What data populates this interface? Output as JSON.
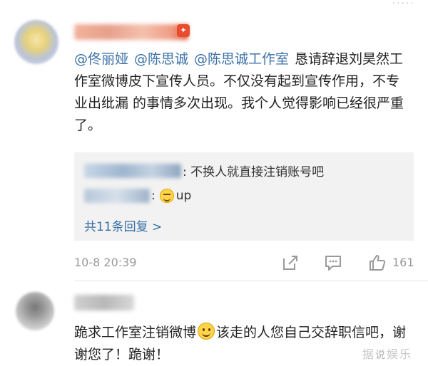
{
  "top": {
    "dots": "·····"
  },
  "comment1": {
    "mentions": [
      "@佟丽娅",
      "@陈思诚",
      "@陈思诚工作室"
    ],
    "body": "恳请辞退刘昊然工作室微博皮下宣传人员。不仅没有起到宣传作用，不专业出纰漏 的事情多次出现。我个人觉得影响已经很严重了。",
    "replies": [
      {
        "text": ": 不换人就直接注销账号吧"
      },
      {
        "text": ":",
        "emoji": "sweat-emoji",
        "suffix": "up"
      }
    ],
    "reply_count_link": "共11条回复 >",
    "timestamp": "10-8 20:39",
    "like_count": "161"
  },
  "comment2": {
    "body_before": "跪求工作室注销微博",
    "body_after": "该走的人您自己交辞职信吧，谢谢您了！跪谢！"
  },
  "watermark": {
    "left": "据",
    "middle": "说",
    "right": "娱乐"
  },
  "colors": {
    "link": "#3a6fa6",
    "meta": "#999999",
    "reply_bg": "#f2f2f2"
  }
}
